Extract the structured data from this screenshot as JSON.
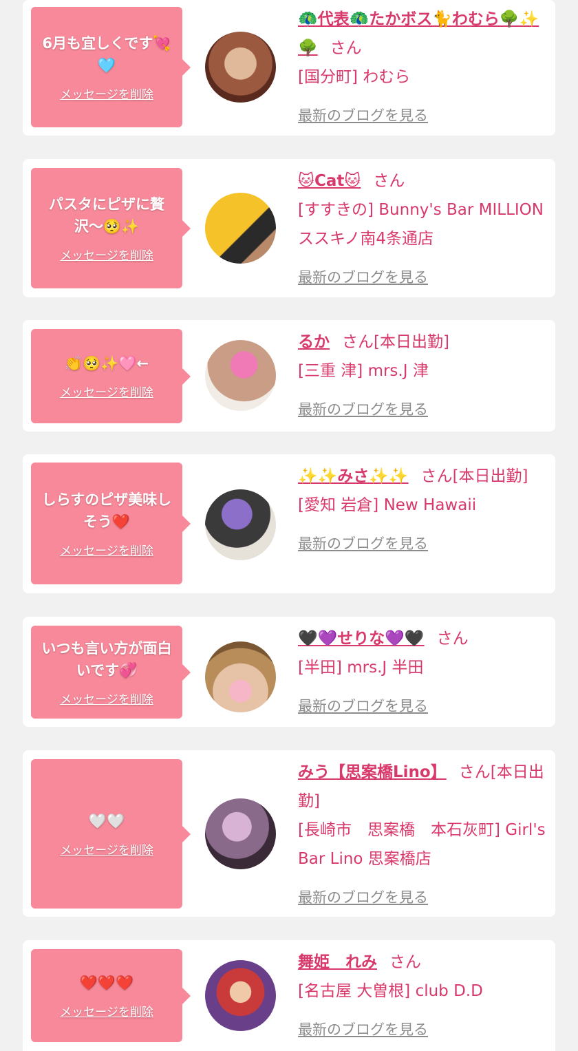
{
  "messages": [
    {
      "message": "6月も宜しくです💘🩵",
      "delete_label": "メッセージを削除",
      "girl_name": "🦚代表🦚たかボス🐈わむら🌳✨🌳",
      "san": "さん",
      "shop": "[国分町] わむら",
      "blog_link": "最新のブログを見る"
    },
    {
      "message": "パスタにピザに贅沢〜🥺✨",
      "delete_label": "メッセージを削除",
      "girl_name": "🐱Cat🐱",
      "san": "さん",
      "shop": "[すすきの] Bunny's Bar MILLION ススキノ南4条通店",
      "blog_link": "最新のブログを見る"
    },
    {
      "message": "👏🥺✨🩷←",
      "delete_label": "メッセージを削除",
      "girl_name": "るか",
      "san": "さん[本日出勤]",
      "shop": "[三重 津] mrs.J 津",
      "blog_link": "最新のブログを見る"
    },
    {
      "message": "しらすのピザ美味しそう❤️",
      "delete_label": "メッセージを削除",
      "girl_name": "✨✨みさ✨✨",
      "san": "さん[本日出勤]",
      "shop": "[愛知 岩倉] New Hawaii",
      "blog_link": "最新のブログを見る"
    },
    {
      "message": "いつも言い方が面白いです💞",
      "delete_label": "メッセージを削除",
      "girl_name": "🖤💜せりな💜🖤",
      "san": "さん",
      "shop": "[半田] mrs.J 半田",
      "blog_link": "最新のブログを見る"
    },
    {
      "message": "🤍🤍",
      "delete_label": "メッセージを削除",
      "girl_name": "みう【思案橋Lino】",
      "san": "さん[本日出勤]",
      "shop": "[長崎市　思案橋　本石灰町] Girl's Bar Lino 思案橋店",
      "blog_link": "最新のブログを見る"
    },
    {
      "message": "❤️❤️❤️",
      "delete_label": "メッセージを削除",
      "girl_name": "舞姫　れみ",
      "san": "さん",
      "shop": "[名古屋 大曽根] club D.D",
      "blog_link": "最新のブログを見る"
    }
  ],
  "colors": {
    "background": "#f1f1f1",
    "bubble": "#f7899a",
    "name_text": "#d8396b",
    "blog_link": "#8c8c8c"
  }
}
